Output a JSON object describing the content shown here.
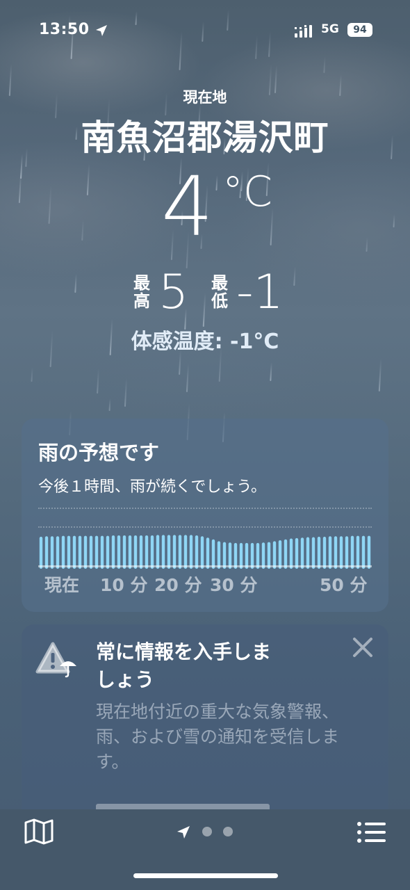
{
  "status_bar": {
    "time": "13:50",
    "network": "5G",
    "battery": "94"
  },
  "location": {
    "label": "現在地",
    "city": "南魚沼郡湯沢町"
  },
  "weather": {
    "temperature": "4",
    "degree_unit": "°C",
    "high_label": "最\n高",
    "high_value": "5",
    "low_label": "最\n低",
    "low_value": "-1",
    "feels_like": "体感温度: -1°C"
  },
  "rain_card": {
    "title": "雨の予想です",
    "subtitle": "今後１時間、雨が続くでしょう。",
    "ticks": [
      "現在",
      "10 分",
      "20 分",
      "30 分",
      "50 分"
    ],
    "intensity": [
      0.72,
      0.73,
      0.73,
      0.73,
      0.74,
      0.74,
      0.74,
      0.74,
      0.74,
      0.74,
      0.74,
      0.74,
      0.74,
      0.75,
      0.75,
      0.75,
      0.75,
      0.75,
      0.75,
      0.75,
      0.75,
      0.76,
      0.76,
      0.76,
      0.76,
      0.76,
      0.76,
      0.76,
      0.75,
      0.73,
      0.7,
      0.66,
      0.62,
      0.6,
      0.59,
      0.58,
      0.58,
      0.58,
      0.58,
      0.58,
      0.59,
      0.6,
      0.62,
      0.64,
      0.66,
      0.68,
      0.69,
      0.7,
      0.71,
      0.71,
      0.72,
      0.72,
      0.73,
      0.73,
      0.73,
      0.73,
      0.74,
      0.74,
      0.74,
      0.74
    ],
    "bar_color": "#8fd6f5"
  },
  "alert_card": {
    "title": "常に情報を入手しましょう",
    "body": "現在地付近の重大な気象警報、雨、および雪の通知を受信します。",
    "icon": "warning-umbrella-icon"
  },
  "bottom_bar": {
    "map_icon": "map-icon",
    "list_icon": "list-icon",
    "page_count": 3,
    "current_page": 0
  }
}
